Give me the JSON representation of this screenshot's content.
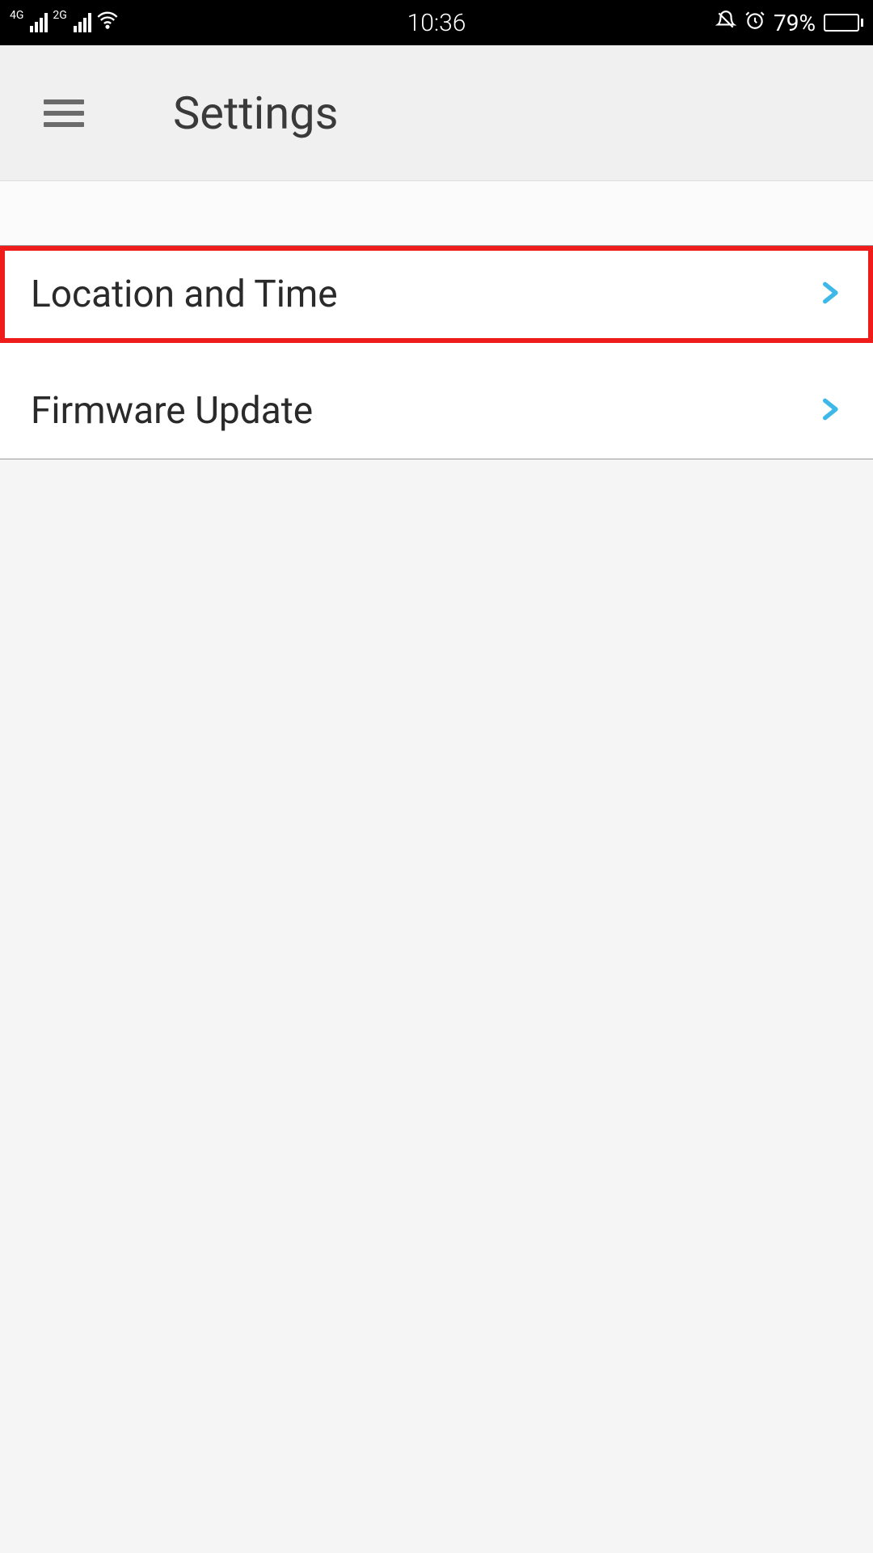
{
  "status": {
    "signal1_label": "4G",
    "signal2_label": "2G",
    "time": "10:36",
    "battery_pct": "79%"
  },
  "header": {
    "title": "Settings"
  },
  "list": {
    "items": [
      {
        "label": "Location and Time"
      },
      {
        "label": "Firmware Update"
      }
    ]
  }
}
